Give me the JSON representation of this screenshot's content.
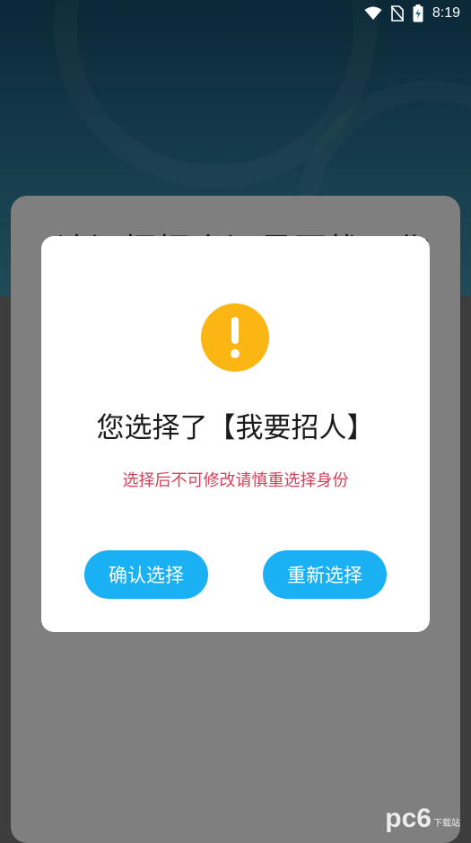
{
  "status_bar": {
    "time": "8:19"
  },
  "background": {
    "card_title": "请问招招人还是要找工作"
  },
  "dialog": {
    "icon": "exclamation-icon",
    "title": "您选择了【我要招人】",
    "warning": "选择后不可修改请慎重选择身份",
    "confirm_label": "确认选择",
    "reselect_label": "重新选择"
  },
  "watermark": {
    "main": "pc6",
    "sub": "下载站"
  },
  "colors": {
    "accent_button": "#1ab0f4",
    "alert_icon": "#fbb614",
    "warning_text": "#d4415a"
  }
}
